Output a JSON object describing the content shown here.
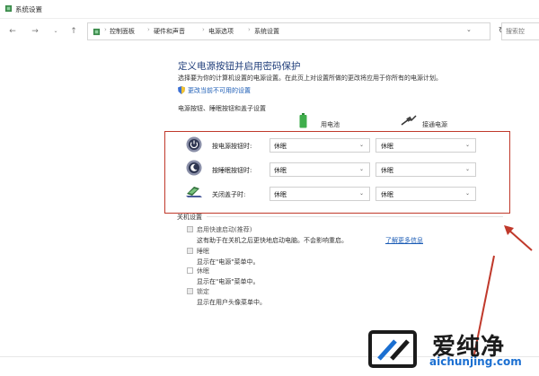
{
  "window": {
    "title": "系统设置"
  },
  "address_bar": {
    "breadcrumbs": [
      "控制面板",
      "硬件和声音",
      "电源选项",
      "系统设置"
    ],
    "search_placeholder": "搜索控"
  },
  "page": {
    "title": "定义电源按钮并启用密码保护",
    "description": "选择要为你的计算机设置的电源设置。在此页上对设置所做的更改将应用于你所有的电源计划。",
    "change_link": "更改当前不可用的设置",
    "section_title": "电源按钮、睡眠按钮和盖子设置",
    "columns": {
      "battery": "用电池",
      "plugged": "接通电源"
    }
  },
  "rows": [
    {
      "label": "按电源按钮时:",
      "battery": "休眠",
      "plugged": "休眠",
      "icon": "power-button-icon"
    },
    {
      "label": "按睡眠按钮时:",
      "battery": "休眠",
      "plugged": "休眠",
      "icon": "sleep-button-icon"
    },
    {
      "label": "关闭盖子时:",
      "battery": "休眠",
      "plugged": "休眠",
      "icon": "laptop-lid-icon"
    }
  ],
  "shutdown": {
    "title": "关机设置",
    "items": [
      {
        "label": "启用快速启动(推荐)",
        "desc": "这有助于在关机之后更快地启动电脑。不会影响重启。",
        "link": "了解更多信息"
      },
      {
        "label": "睡眠",
        "desc": "显示在\"电源\"菜单中。"
      },
      {
        "label": "休眠",
        "desc": "显示在\"电源\"菜单中。"
      },
      {
        "label": "锁定",
        "desc": "显示在用户头像菜单中。"
      }
    ]
  },
  "watermark": {
    "brand": "爱纯净",
    "url": "aichunjing.com"
  },
  "colors": {
    "annotation": "#c0392b",
    "link": "#1a5bb5",
    "title": "#1f3d7a",
    "watermark_url": "#1b6fd1"
  }
}
